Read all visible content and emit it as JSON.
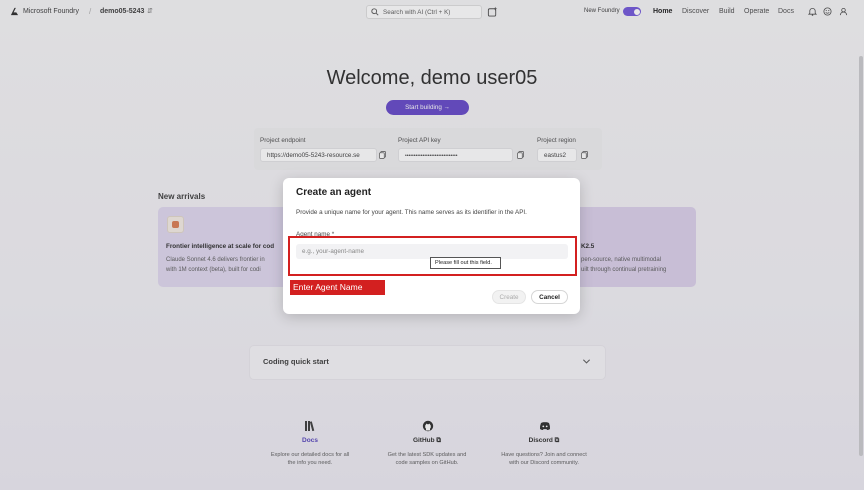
{
  "header": {
    "brand": "Microsoft Foundry",
    "separator": "/",
    "project": "demo05-5243",
    "search_placeholder": "Search with AI (Ctrl + K)",
    "new_foundry_label": "New Foundry",
    "nav": [
      "Home",
      "Discover",
      "Build",
      "Operate",
      "Docs"
    ],
    "active_nav": "Home"
  },
  "hero": {
    "title": "Welcome, demo user05",
    "start_button": "Start building →"
  },
  "project_info": {
    "endpoint_label": "Project endpoint",
    "endpoint_value": "https://demo05-5243-resource.se",
    "api_key_label": "Project API key",
    "api_key_value": "••••••••••••••••••••••••••••••",
    "region_label": "Project region",
    "region_value": "eastus2"
  },
  "new_arrivals": {
    "heading": "New arrivals",
    "card_left": {
      "title": "Frontier intelligence at scale for cod",
      "line1": "Claude Sonnet 4.6 delivers frontier in",
      "line2": "with 1M context (beta), built for codi"
    },
    "card_right": {
      "title": "K2.5",
      "line1": "pen-source, native multimodal",
      "line2": "uilt through continual pretraining"
    }
  },
  "coding": {
    "label": "Coding quick start"
  },
  "resources": [
    {
      "title": "Docs",
      "desc1": "Explore our detailed docs for all",
      "desc2": "the info you need."
    },
    {
      "title": "GitHub ⧉",
      "desc1": "Get the latest SDK updates and",
      "desc2": "code samples on GitHub."
    },
    {
      "title": "Discord ⧉",
      "desc1": "Have questions? Join and connect",
      "desc2": "with our Discord community."
    }
  ],
  "modal": {
    "title": "Create an agent",
    "description": "Provide a unique name for your agent. This name serves as its identifier in the API.",
    "field_label": "Agent name *",
    "input_placeholder": "e.g., your-agent-name",
    "input_value": "",
    "validation_tooltip": "Please fill out this field.",
    "create_button": "Create",
    "cancel_button": "Cancel"
  },
  "annotation": {
    "label": "Enter Agent Name",
    "color": "#d32020"
  },
  "colors": {
    "accent": "#5d3fc6",
    "toggle": "#6b4fd8"
  }
}
